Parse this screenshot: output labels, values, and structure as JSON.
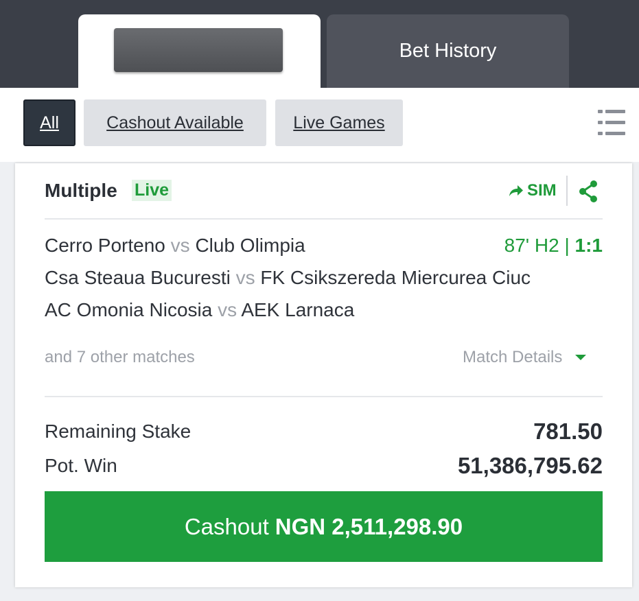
{
  "tabs": {
    "bet_history_label": "Bet History"
  },
  "filters": {
    "all_label": "All",
    "cashout_available_label": "Cashout Available",
    "live_games_label": "Live Games"
  },
  "bet": {
    "type_label": "Multiple",
    "live_badge": "Live",
    "sim_label": "SIM",
    "matches": [
      {
        "home": "Cerro Porteno",
        "vs": "vs",
        "away": "Club Olimpia"
      },
      {
        "home": "Csa Steaua Bucuresti",
        "vs": "vs",
        "away": "FK Csikszereda Miercurea Ciuc"
      },
      {
        "home": "AC Omonia Nicosia",
        "vs": "vs",
        "away": "AEK Larnaca"
      }
    ],
    "live_status": {
      "time": "87' H2 |",
      "score": "1:1"
    },
    "other_matches": "and 7 other matches",
    "match_details_label": "Match Details",
    "remaining_stake_label": "Remaining Stake",
    "remaining_stake_value": "781.50",
    "pot_win_label": "Pot. Win",
    "pot_win_value": "51,386,795.62",
    "cashout_label": "Cashout",
    "cashout_amount": "NGN 2,511,298.90"
  },
  "colors": {
    "accent_green": "#1e9e3e",
    "header_dark": "#3b3f48"
  },
  "icons": [
    "list-icon",
    "share-arrow-icon",
    "share-icon",
    "caret-down-icon"
  ]
}
